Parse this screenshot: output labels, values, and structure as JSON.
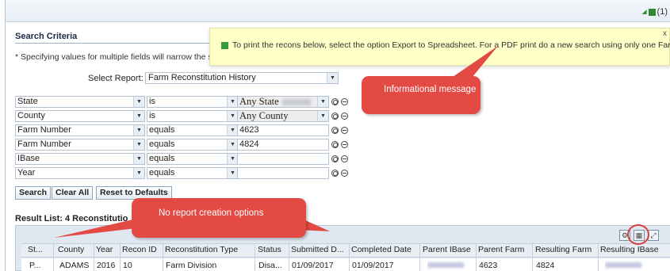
{
  "top_bar": {
    "message_count": "(1)"
  },
  "search_criteria": {
    "title": "Search Criteria",
    "hint": "* Specifying values for multiple fields will narrow the se"
  },
  "info_message": {
    "text": "To print the recons below, select the option Export to Spreadsheet. For a PDF print do a new search using only one Farm.",
    "close": "x"
  },
  "report": {
    "label": "Select Report:",
    "value": "Farm Reconstitution History"
  },
  "criteria_rows": [
    {
      "field": "State",
      "operator": "is",
      "value": "Any State"
    },
    {
      "field": "County",
      "operator": "is",
      "value": "Any County"
    },
    {
      "field": "Farm Number",
      "operator": "equals",
      "value": "4623"
    },
    {
      "field": "Farm Number",
      "operator": "equals",
      "value": "4824"
    },
    {
      "field": "IBase",
      "operator": "equals",
      "value": ""
    },
    {
      "field": "Year",
      "operator": "equals",
      "value": ""
    }
  ],
  "buttons": {
    "search": "Search",
    "clear_all": "Clear All",
    "reset": "Reset to Defaults"
  },
  "result_list": {
    "title": "Result List: 4 Reconstitutio",
    "columns": [
      "St...",
      "County",
      "Year",
      "Recon ID",
      "Reconstitution Type",
      "Status",
      "Submitted D...",
      "Completed Date",
      "Parent IBase",
      "Parent Farm",
      "Resulting Farm",
      "Resulting IBase"
    ],
    "rows": [
      [
        "P...",
        "ADAMS",
        "2016",
        "10",
        "Farm Division",
        "Disa...",
        "01/09/2017",
        "01/09/2017",
        "",
        "4623",
        "4824",
        ""
      ]
    ]
  },
  "annotations": {
    "informational": "Informational message",
    "no_report": "No report creation options"
  },
  "colors": {
    "callout": "#e24a43",
    "tooltip_bg": "#ffffc8",
    "msg_green": "#2f8a2f"
  },
  "icons": [
    "message-icon",
    "settings-icon",
    "export-spreadsheet-icon",
    "expand-icon",
    "add-row-icon",
    "remove-row-icon",
    "dropdown-icon"
  ]
}
